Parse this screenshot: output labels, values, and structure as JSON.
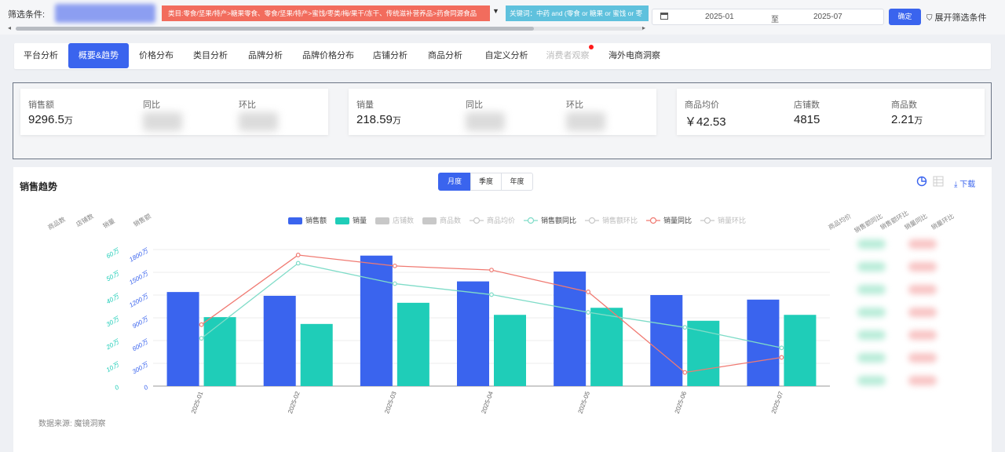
{
  "filter": {
    "label": "筛选条件:",
    "category_tag": "类目:零食/坚果/特产>糖果零食、零食/坚果/特产>蜜饯/枣类/梅/果干/冻干、传统滋补营养品>药食同源食品",
    "keyword_tag": "关键词：中药 and (零食 or 糖果 or 蜜饯 or 枣",
    "date_start": "2025-01",
    "date_to": "至",
    "date_end": "2025-07",
    "confirm_label": "确定",
    "expand_label": "展开筛选条件",
    "colors": {
      "category": "#f26c5d",
      "keyword": "#5fc1dd",
      "primary": "#3a64ee"
    }
  },
  "tabs": [
    {
      "label": "平台分析",
      "state": "normal"
    },
    {
      "label": "概要&趋势",
      "state": "active"
    },
    {
      "label": "价格分布",
      "state": "normal"
    },
    {
      "label": "类目分析",
      "state": "normal"
    },
    {
      "label": "品牌分析",
      "state": "normal"
    },
    {
      "label": "品牌价格分布",
      "state": "normal"
    },
    {
      "label": "店铺分析",
      "state": "normal"
    },
    {
      "label": "商品分析",
      "state": "normal"
    },
    {
      "label": "自定义分析",
      "state": "normal"
    },
    {
      "label": "消费者观察",
      "state": "disabled"
    },
    {
      "label": "海外电商洞察",
      "state": "normal"
    }
  ],
  "kpis": {
    "sales_label": "销售额",
    "sales_value": "9296.5",
    "sales_unit": "万",
    "sales_yoy_label": "同比",
    "sales_mom_label": "环比",
    "volume_label": "销量",
    "volume_value": "218.59",
    "volume_unit": "万",
    "volume_yoy_label": "同比",
    "volume_mom_label": "环比",
    "avg_price_label": "商品均价",
    "avg_price_value": "￥42.53",
    "shops_label": "店铺数",
    "shops_value": "4815",
    "products_label": "商品数",
    "products_value": "2.21",
    "products_unit": "万"
  },
  "trend": {
    "title": "销售趋势",
    "periods": [
      "月度",
      "季度",
      "年度"
    ],
    "active_period": "月度",
    "download_label": "下载",
    "source": "数据来源: 魔镜洞察",
    "left_axis_titles": [
      "商品数",
      "店铺数",
      "销量",
      "销售额"
    ],
    "right_axis_titles": [
      "商品均价",
      "销售额同比",
      "销售额环比",
      "销量同比",
      "销量环比"
    ]
  },
  "chart_data": {
    "type": "bar",
    "categories": [
      "2025-01",
      "2025-02",
      "2025-03",
      "2025-04",
      "2025-05",
      "2025-06",
      "2025-07"
    ],
    "legend": [
      {
        "name": "销售额",
        "kind": "bar",
        "color": "#3a64ee",
        "active": true
      },
      {
        "name": "销量",
        "kind": "bar",
        "color": "#1fcdb8",
        "active": true
      },
      {
        "name": "店铺数",
        "kind": "bar",
        "color": "#c8c8c8",
        "active": false
      },
      {
        "name": "商品数",
        "kind": "bar",
        "color": "#c8c8c8",
        "active": false
      },
      {
        "name": "商品均价",
        "kind": "line",
        "color": "#c8c8c8",
        "active": false
      },
      {
        "name": "销售额同比",
        "kind": "line",
        "color": "#7fdcc8",
        "active": true
      },
      {
        "name": "销售额环比",
        "kind": "line",
        "color": "#c8c8c8",
        "active": false
      },
      {
        "name": "销量同比",
        "kind": "line",
        "color": "#f07a72",
        "active": true
      },
      {
        "name": "销量环比",
        "kind": "line",
        "color": "#c8c8c8",
        "active": false
      }
    ],
    "series": [
      {
        "name": "销售额",
        "axis": "sales",
        "values": [
          1240,
          1190,
          1720,
          1380,
          1510,
          1200,
          1140
        ]
      },
      {
        "name": "销量",
        "axis": "volume",
        "values": [
          30.3,
          27.3,
          36.6,
          31.3,
          34.4,
          28.7,
          31.3
        ]
      },
      {
        "name": "销售额同比",
        "axis": "ratio",
        "values": [
          0.35,
          0.9,
          0.75,
          0.67,
          0.54,
          0.43,
          0.28
        ]
      },
      {
        "name": "销量同比",
        "axis": "ratio",
        "values": [
          0.45,
          0.96,
          0.88,
          0.85,
          0.69,
          0.1,
          0.21
        ]
      }
    ],
    "sales_axis": {
      "ticks": [
        "0",
        "300万",
        "600万",
        "900万",
        "1200万",
        "1500万",
        "1800万"
      ],
      "range": [
        0,
        1800
      ],
      "color": "#3a64ee"
    },
    "volume_axis": {
      "ticks": [
        "0",
        "10万",
        "20万",
        "30万",
        "40万",
        "50万",
        "60万"
      ],
      "range": [
        0,
        60
      ],
      "color": "#1fcdb8"
    },
    "grid": true
  }
}
